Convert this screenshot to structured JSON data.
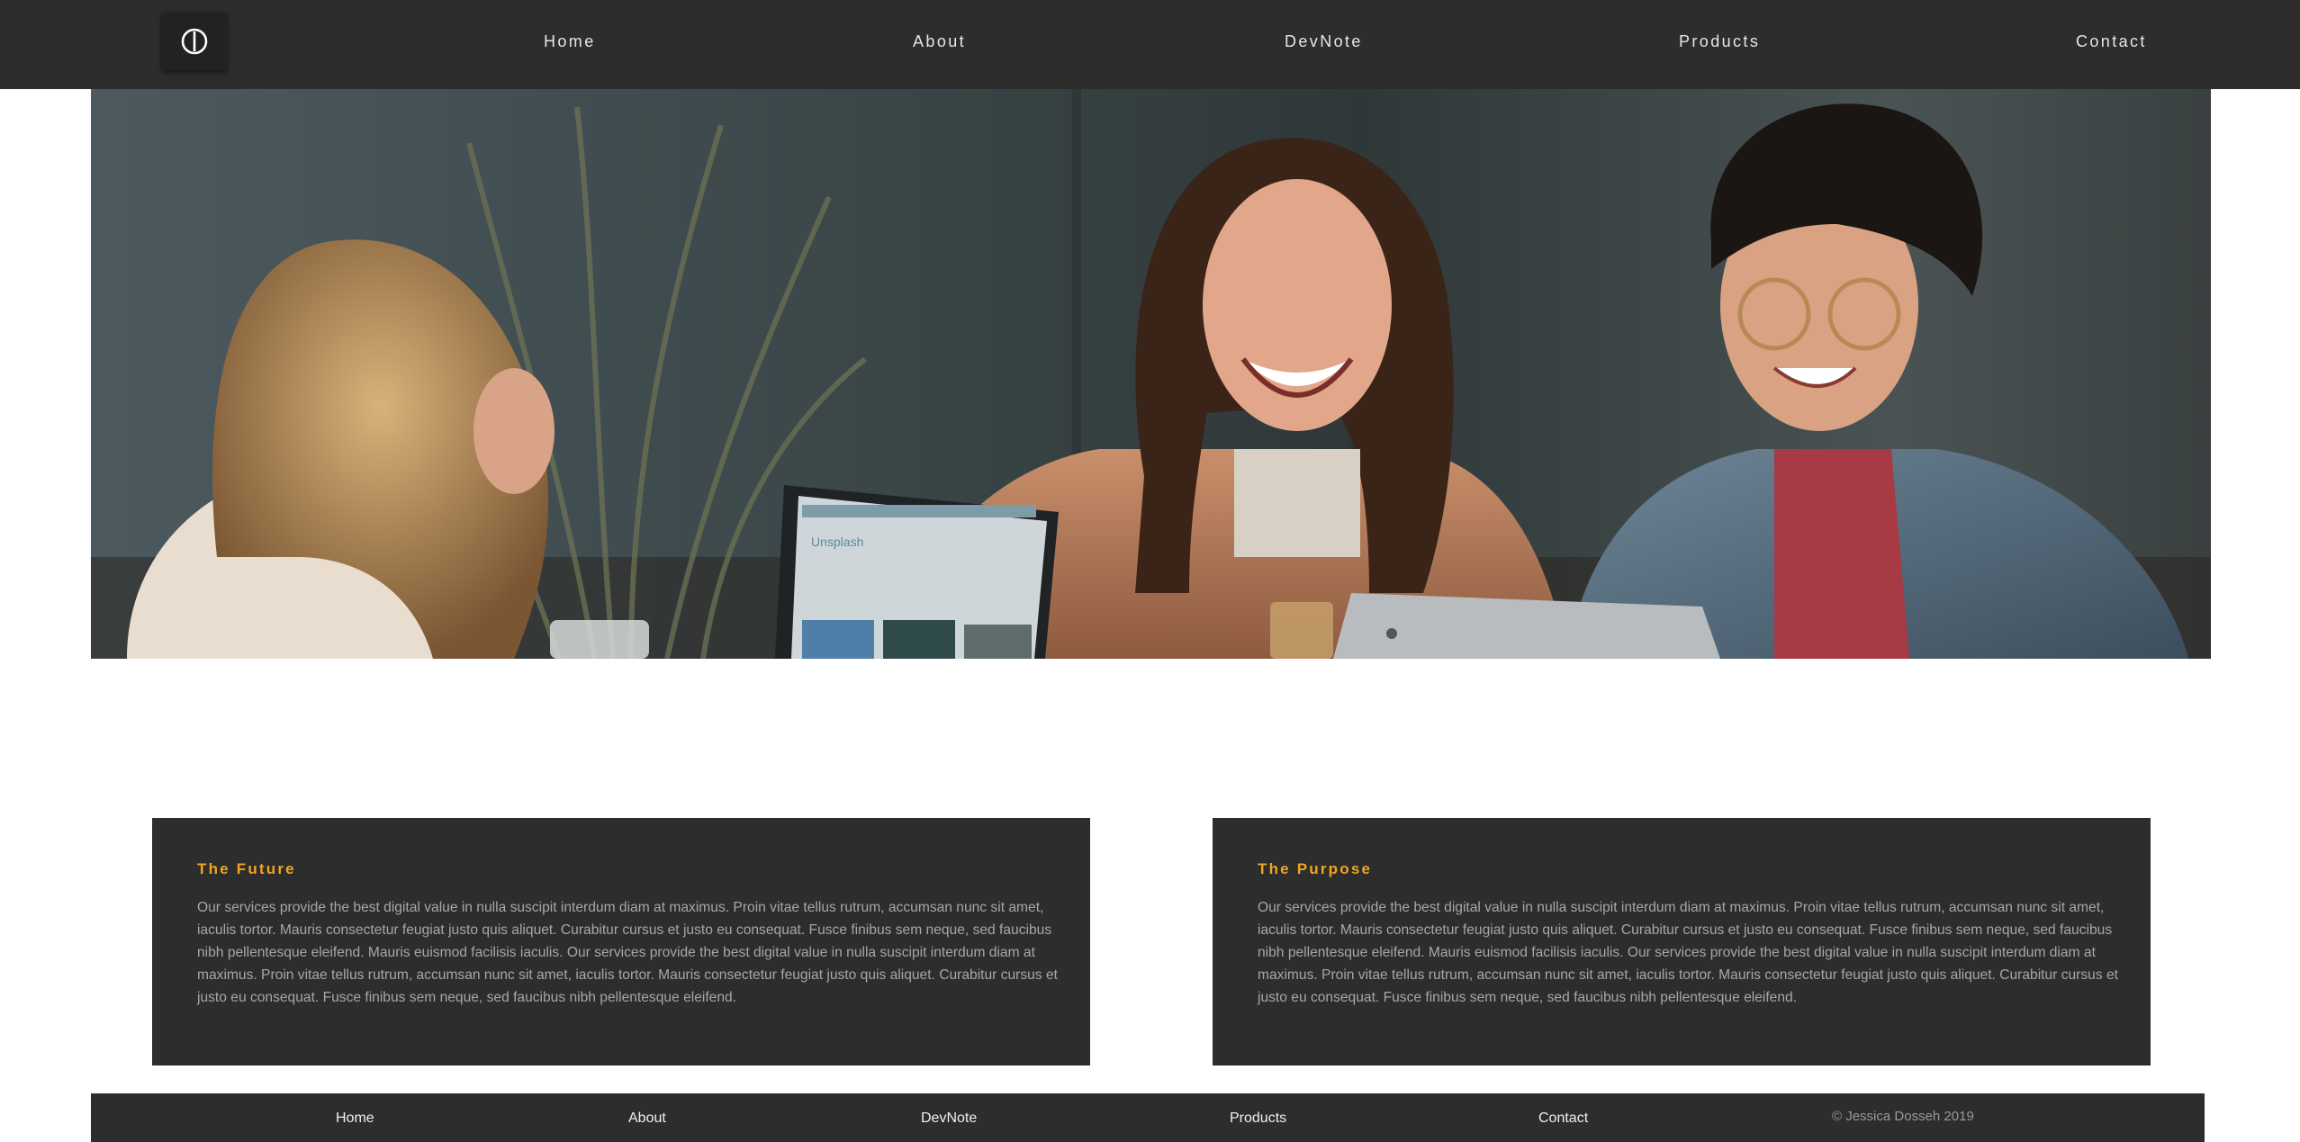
{
  "brand": {
    "logo_icon": "power-circle-icon"
  },
  "nav": {
    "items": [
      {
        "label": "Home"
      },
      {
        "label": "About"
      },
      {
        "label": "DevNote"
      },
      {
        "label": "Products"
      },
      {
        "label": "Contact"
      }
    ]
  },
  "hero": {
    "image": "three-women-laughing-at-cafe-table-with-laptops",
    "laptop_screen_text": "Unsplash"
  },
  "cards": [
    {
      "title": "The Future",
      "body": "Our services provide the best digital value in nulla suscipit interdum diam at maximus. Proin vitae tellus rutrum, accumsan nunc sit amet, iaculis tortor. Mauris consectetur feugiat justo quis aliquet. Curabitur cursus et justo eu consequat. Fusce finibus sem neque, sed faucibus nibh pellentesque eleifend. Mauris euismod facilisis iaculis. Our services provide the best digital value in nulla suscipit interdum diam at maximus. Proin vitae tellus rutrum, accumsan nunc sit amet, iaculis tortor. Mauris consectetur feugiat justo quis aliquet. Curabitur cursus et justo eu consequat. Fusce finibus sem neque, sed faucibus nibh pellentesque eleifend."
    },
    {
      "title": "The Purpose",
      "body": "Our services provide the best digital value in nulla suscipit interdum diam at maximus. Proin vitae tellus rutrum, accumsan nunc sit amet, iaculis tortor. Mauris consectetur feugiat justo quis aliquet. Curabitur cursus et justo eu consequat. Fusce finibus sem neque, sed faucibus nibh pellentesque eleifend. Mauris euismod facilisis iaculis. Our services provide the best digital value in nulla suscipit interdum diam at maximus. Proin vitae tellus rutrum, accumsan nunc sit amet, iaculis tortor. Mauris consectetur feugiat justo quis aliquet. Curabitur cursus et justo eu consequat. Fusce finibus sem neque, sed faucibus nibh pellentesque eleifend."
    }
  ],
  "footer": {
    "items": [
      {
        "label": "Home"
      },
      {
        "label": "About"
      },
      {
        "label": "DevNote"
      },
      {
        "label": "Products"
      },
      {
        "label": "Contact"
      }
    ],
    "copyright": "© Jessica Dosseh 2019"
  },
  "colors": {
    "nav_bg": "#2d2d2d",
    "card_bg": "#2d2d2d",
    "accent": "#f0a424",
    "body_text": "#a7a7a7"
  }
}
